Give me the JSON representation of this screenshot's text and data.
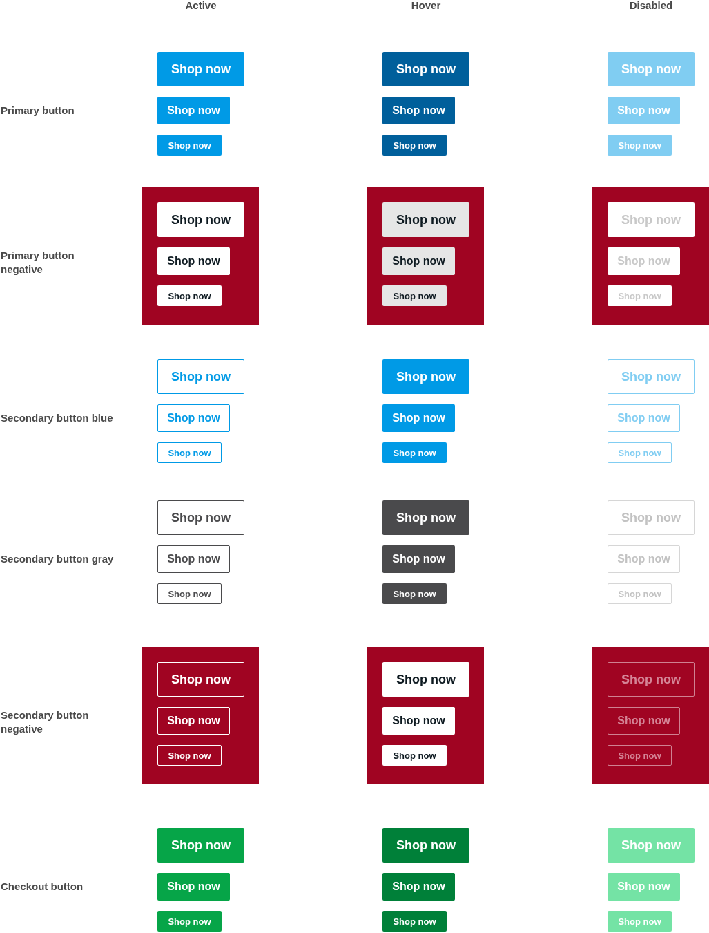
{
  "columns": [
    {
      "label": "Active"
    },
    {
      "label": "Hover"
    },
    {
      "label": "Disabled"
    }
  ],
  "rows": [
    {
      "label": "Primary button",
      "kind": "primary",
      "cells": [
        {
          "hovered": false,
          "disabled": false,
          "buttons": [
            {
              "kind": "large",
              "label": "Shop now"
            },
            {
              "kind": "medium",
              "label": "Shop now"
            },
            {
              "kind": "small",
              "label": "Shop now"
            }
          ]
        },
        {
          "hovered": true,
          "disabled": false,
          "buttons": [
            {
              "kind": "large",
              "label": "Shop now"
            },
            {
              "kind": "medium",
              "label": "Shop now"
            },
            {
              "kind": "small",
              "label": "Shop now"
            }
          ]
        },
        {
          "hovered": false,
          "disabled": true,
          "buttons": [
            {
              "kind": "large",
              "label": "Shop now"
            },
            {
              "kind": "medium",
              "label": "Shop now"
            },
            {
              "kind": "small",
              "label": "Shop now"
            }
          ]
        }
      ]
    },
    {
      "label": "Primary button negative",
      "kind": "inverse",
      "cells": [
        {
          "hovered": false,
          "disabled": false,
          "buttons": [
            {
              "kind": "large",
              "label": "Shop now"
            },
            {
              "kind": "medium",
              "label": "Shop now"
            },
            {
              "kind": "small",
              "label": "Shop now"
            }
          ]
        },
        {
          "hovered": true,
          "disabled": false,
          "buttons": [
            {
              "kind": "large",
              "label": "Shop now"
            },
            {
              "kind": "medium",
              "label": "Shop now"
            },
            {
              "kind": "small",
              "label": "Shop now"
            }
          ]
        },
        {
          "hovered": false,
          "disabled": true,
          "buttons": [
            {
              "kind": "large",
              "label": "Shop now"
            },
            {
              "kind": "medium",
              "label": "Shop now"
            },
            {
              "kind": "small",
              "label": "Shop now"
            }
          ]
        }
      ]
    },
    {
      "label": "Secondary button blue",
      "kind": "outline",
      "cells": [
        {
          "hovered": false,
          "disabled": false,
          "buttons": [
            {
              "kind": "large",
              "label": "Shop now"
            },
            {
              "kind": "medium",
              "label": "Shop now"
            },
            {
              "kind": "small",
              "label": "Shop now"
            }
          ]
        },
        {
          "hovered": true,
          "disabled": false,
          "buttons": [
            {
              "kind": "large",
              "label": "Shop now"
            },
            {
              "kind": "medium",
              "label": "Shop now"
            },
            {
              "kind": "small",
              "label": "Shop now"
            }
          ]
        },
        {
          "hovered": false,
          "disabled": true,
          "buttons": [
            {
              "kind": "large",
              "label": "Shop now"
            },
            {
              "kind": "medium",
              "label": "Shop now"
            },
            {
              "kind": "small",
              "label": "Shop now"
            }
          ]
        }
      ]
    },
    {
      "label": "Secondary button gray",
      "kind": "neutral",
      "cells": [
        {
          "hovered": false,
          "disabled": false,
          "buttons": [
            {
              "kind": "large",
              "label": "Shop now"
            },
            {
              "kind": "medium",
              "label": "Shop now"
            },
            {
              "kind": "small",
              "label": "Shop now"
            }
          ]
        },
        {
          "hovered": true,
          "disabled": false,
          "buttons": [
            {
              "kind": "large",
              "label": "Shop now"
            },
            {
              "kind": "medium",
              "label": "Shop now"
            },
            {
              "kind": "small",
              "label": "Shop now"
            }
          ]
        },
        {
          "hovered": false,
          "disabled": true,
          "buttons": [
            {
              "kind": "large",
              "label": "Shop now"
            },
            {
              "kind": "medium",
              "label": "Shop now"
            },
            {
              "kind": "small",
              "label": "Shop now"
            }
          ]
        }
      ]
    },
    {
      "label": "Secondary button negative",
      "kind": "ghost",
      "cells": [
        {
          "hovered": false,
          "disabled": false,
          "buttons": [
            {
              "kind": "large",
              "label": "Shop now"
            },
            {
              "kind": "medium",
              "label": "Shop now"
            },
            {
              "kind": "small",
              "label": "Shop now"
            }
          ]
        },
        {
          "hovered": true,
          "disabled": false,
          "buttons": [
            {
              "kind": "large",
              "label": "Shop now"
            },
            {
              "kind": "medium",
              "label": "Shop now"
            },
            {
              "kind": "small",
              "label": "Shop now"
            }
          ]
        },
        {
          "hovered": false,
          "disabled": true,
          "buttons": [
            {
              "kind": "large",
              "label": "Shop now"
            },
            {
              "kind": "medium",
              "label": "Shop now"
            },
            {
              "kind": "small",
              "label": "Shop now"
            }
          ]
        }
      ]
    },
    {
      "label": "Checkout button",
      "kind": "checkout",
      "cells": [
        {
          "hovered": false,
          "disabled": false,
          "buttons": [
            {
              "kind": "large",
              "label": "Shop now"
            },
            {
              "kind": "medium",
              "label": "Shop now"
            },
            {
              "kind": "small",
              "label": "Shop now"
            }
          ]
        },
        {
          "hovered": true,
          "disabled": false,
          "buttons": [
            {
              "kind": "large",
              "label": "Shop now"
            },
            {
              "kind": "medium",
              "label": "Shop now"
            },
            {
              "kind": "small",
              "label": "Shop now"
            }
          ]
        },
        {
          "hovered": false,
          "disabled": true,
          "buttons": [
            {
              "kind": "large",
              "label": "Shop now"
            },
            {
              "kind": "medium",
              "label": "Shop now"
            },
            {
              "kind": "small",
              "label": "Shop now"
            }
          ]
        }
      ]
    }
  ]
}
